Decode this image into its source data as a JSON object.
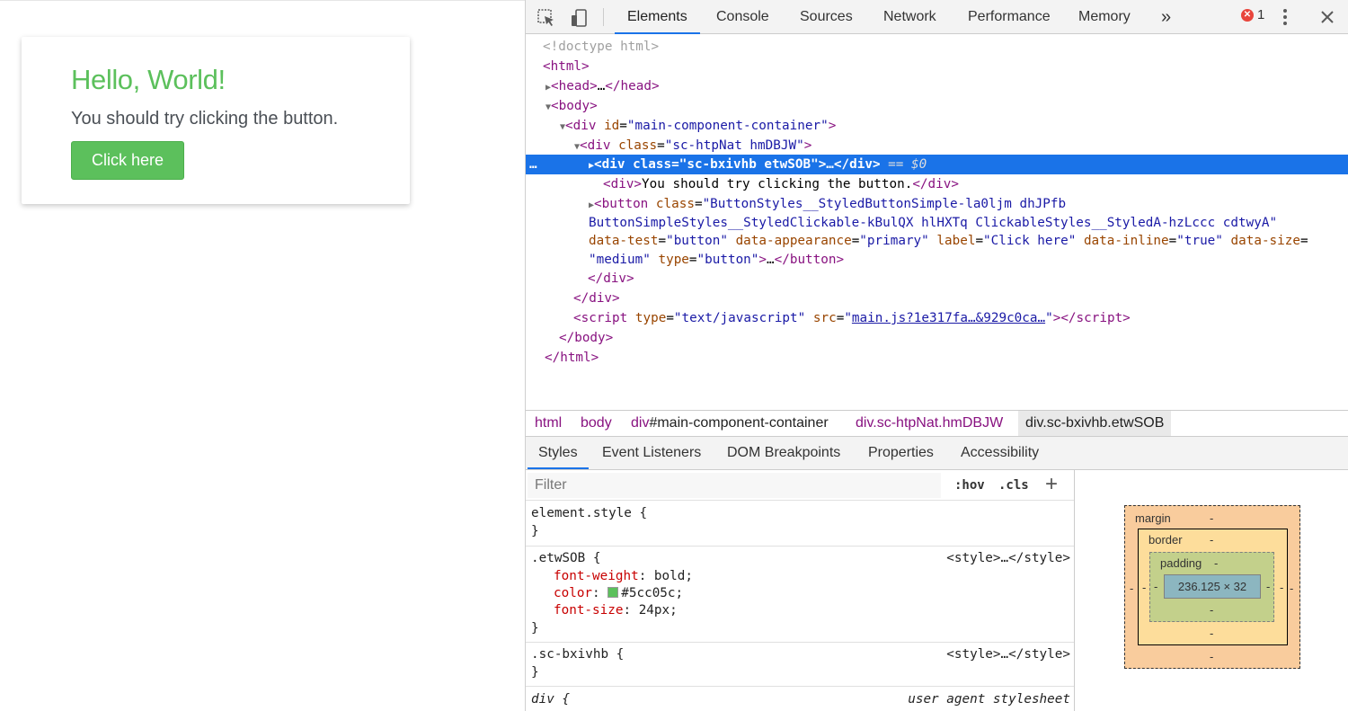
{
  "page": {
    "title": "Hello, World!",
    "subtitle": "You should try clicking the button.",
    "button_label": "Click here",
    "accent_color": "#5cc05c"
  },
  "devtools": {
    "toolbar": {
      "tabs": [
        "Elements",
        "Console",
        "Sources",
        "Network",
        "Performance",
        "Memory"
      ],
      "more": "»",
      "error_count": "1"
    },
    "dom_lines": [
      {
        "doctype": "<!doctype html>"
      },
      {
        "open": "<html>"
      },
      {
        "tag": "head",
        "text": "…"
      },
      {
        "open": "<body>"
      },
      {
        "tag": "div",
        "attr_name": "id",
        "attr_value": "main-component-container"
      },
      {
        "tag": "div",
        "attr_name": "class",
        "attr_value": "sc-htpNat hmDBJW"
      },
      {
        "tag": "div",
        "attr_name": "class",
        "attr_value": "sc-bxivhb etwSOB",
        "selected_suffix": "== $0",
        "ellipsis": "…"
      },
      {
        "text": "You should try clicking the button."
      },
      {
        "tag": "button",
        "class_value_1": "ButtonStyles__StyledButtonSimple-la0ljm dhJPfb",
        "class_value_2": "ButtonSimpleStyles__StyledClickable-kBulQX hlHXTq ClickableStyles__StyledA-hzLccc cdtwyA",
        "data_test": "button",
        "data_appearance": "primary",
        "label": "Click here",
        "data_inline": "true",
        "data_size": "medium",
        "type": "button"
      },
      {
        "close": "</div>"
      },
      {
        "close": "</div>"
      },
      {
        "script_type": "text/javascript",
        "script_src": "main.js?1e317fa…&929c0ca…"
      },
      {
        "close": "</body>"
      },
      {
        "close": "</html>"
      }
    ],
    "breadcrumbs": [
      {
        "tag": "html",
        "rest": ""
      },
      {
        "tag": "body",
        "rest": ""
      },
      {
        "tag": "div",
        "rest": "#main-component-container"
      },
      {
        "tag": "div",
        "rest": ".sc-htpNat.hmDBJW"
      },
      {
        "tag": "div",
        "rest": ".sc-bxivhb.etwSOB"
      }
    ],
    "panel_tabs": [
      "Styles",
      "Event Listeners",
      "DOM Breakpoints",
      "Properties",
      "Accessibility"
    ],
    "styles": {
      "filter_placeholder": "Filter",
      "hov": ":hov",
      "cls": ".cls",
      "plus": "+",
      "rules": [
        {
          "selector": "element.style {",
          "close": "}"
        },
        {
          "selector": ".etwSOB {",
          "source": "<style>…</style>",
          "props": [
            {
              "name": "font-weight",
              "value": "bold;"
            },
            {
              "name": "color",
              "value": "#5cc05c;",
              "swatch": "#5cc05c"
            },
            {
              "name": "font-size",
              "value": "24px;"
            }
          ],
          "close": "}"
        },
        {
          "selector": ".sc-bxivhb {",
          "source": "<style>…</style>",
          "close": "}"
        },
        {
          "selector": "div {",
          "source": "user agent stylesheet"
        }
      ]
    },
    "box_model": {
      "margin_label": "margin",
      "border_label": "border",
      "padding_label": "padding",
      "content_size": "236.125 × 32",
      "dash": "-"
    }
  }
}
